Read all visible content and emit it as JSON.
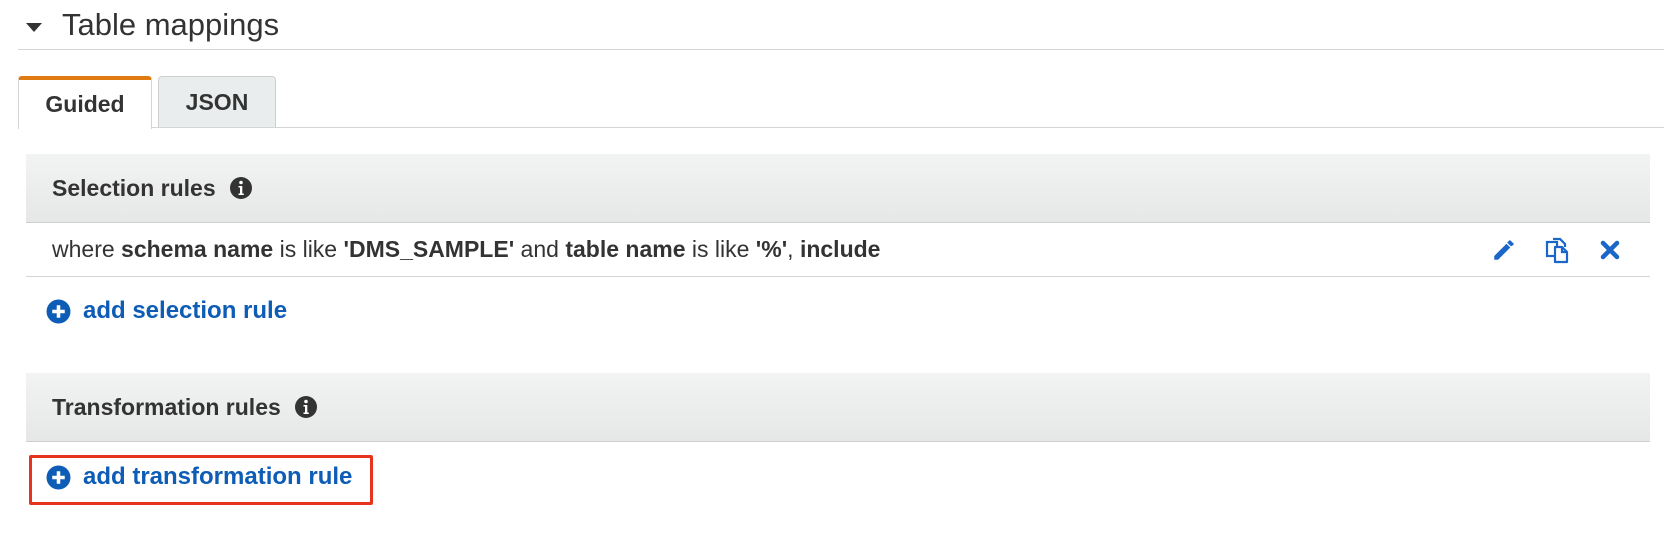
{
  "section": {
    "title": "Table mappings"
  },
  "tabs": [
    {
      "label": "Guided"
    },
    {
      "label": "JSON"
    }
  ],
  "selection": {
    "title": "Selection rules",
    "rule": {
      "w1": "where ",
      "b1": "schema name",
      "w2": " is like ",
      "b2": "'DMS_SAMPLE'",
      "w3": " and ",
      "b3": "table name",
      "w4": " is like ",
      "b4": "'%'",
      "w5": ", ",
      "b5": "include"
    },
    "add_label": "add selection rule"
  },
  "transformation": {
    "title": "Transformation rules",
    "add_label": "add transformation rule"
  },
  "colors": {
    "link": "#0d5cb6",
    "tab_accent": "#e07b12",
    "highlight": "#e8331c"
  }
}
